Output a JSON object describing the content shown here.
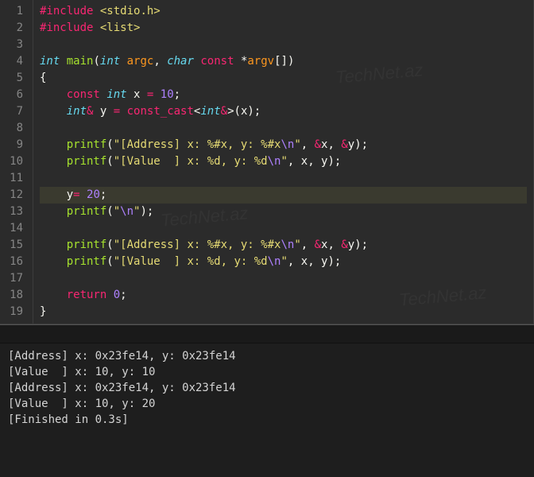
{
  "editor": {
    "lines": [
      {
        "num": "1",
        "hl": false,
        "tokens": [
          [
            "red",
            "#include"
          ],
          [
            "default",
            " "
          ],
          [
            "string",
            "<stdio.h>"
          ]
        ]
      },
      {
        "num": "2",
        "hl": false,
        "tokens": [
          [
            "red",
            "#include"
          ],
          [
            "default",
            " "
          ],
          [
            "string",
            "<list>"
          ]
        ]
      },
      {
        "num": "3",
        "hl": false,
        "tokens": []
      },
      {
        "num": "4",
        "hl": false,
        "tokens": [
          [
            "cyan",
            "int"
          ],
          [
            "default",
            " "
          ],
          [
            "green",
            "main"
          ],
          [
            "default",
            "("
          ],
          [
            "cyan",
            "int"
          ],
          [
            "default",
            " "
          ],
          [
            "orange",
            "argc"
          ],
          [
            "default",
            ", "
          ],
          [
            "cyan",
            "char"
          ],
          [
            "default",
            " "
          ],
          [
            "red",
            "const"
          ],
          [
            "default",
            " *"
          ],
          [
            "orange",
            "argv"
          ],
          [
            "default",
            "[])"
          ]
        ]
      },
      {
        "num": "5",
        "hl": false,
        "tokens": [
          [
            "default",
            "{"
          ]
        ]
      },
      {
        "num": "6",
        "hl": false,
        "tokens": [
          [
            "default",
            "    "
          ],
          [
            "red",
            "const"
          ],
          [
            "default",
            " "
          ],
          [
            "cyan",
            "int"
          ],
          [
            "default",
            " x "
          ],
          [
            "red",
            "="
          ],
          [
            "default",
            " "
          ],
          [
            "num",
            "10"
          ],
          [
            "default",
            ";"
          ]
        ]
      },
      {
        "num": "7",
        "hl": false,
        "tokens": [
          [
            "default",
            "    "
          ],
          [
            "cyan",
            "int"
          ],
          [
            "red",
            "&"
          ],
          [
            "default",
            " y "
          ],
          [
            "red",
            "="
          ],
          [
            "default",
            " "
          ],
          [
            "red",
            "const_cast"
          ],
          [
            "default",
            "<"
          ],
          [
            "cyan",
            "int"
          ],
          [
            "red",
            "&"
          ],
          [
            "default",
            ">(x);"
          ]
        ]
      },
      {
        "num": "8",
        "hl": false,
        "tokens": []
      },
      {
        "num": "9",
        "hl": false,
        "tokens": [
          [
            "default",
            "    "
          ],
          [
            "green",
            "printf"
          ],
          [
            "default",
            "("
          ],
          [
            "string",
            "\"[Address] x: %#x, y: %#x"
          ],
          [
            "num",
            "\\n"
          ],
          [
            "string",
            "\""
          ],
          [
            "default",
            ", "
          ],
          [
            "red",
            "&"
          ],
          [
            "default",
            "x, "
          ],
          [
            "red",
            "&"
          ],
          [
            "default",
            "y);"
          ]
        ]
      },
      {
        "num": "10",
        "hl": false,
        "tokens": [
          [
            "default",
            "    "
          ],
          [
            "green",
            "printf"
          ],
          [
            "default",
            "("
          ],
          [
            "string",
            "\"[Value  ] x: %d, y: %d"
          ],
          [
            "num",
            "\\n"
          ],
          [
            "string",
            "\""
          ],
          [
            "default",
            ", x, y);"
          ]
        ]
      },
      {
        "num": "11",
        "hl": false,
        "tokens": []
      },
      {
        "num": "12",
        "hl": true,
        "tokens": [
          [
            "default",
            "    y"
          ],
          [
            "red",
            "="
          ],
          [
            "default",
            " "
          ],
          [
            "num",
            "20"
          ],
          [
            "default",
            ";"
          ]
        ]
      },
      {
        "num": "13",
        "hl": false,
        "tokens": [
          [
            "default",
            "    "
          ],
          [
            "green",
            "printf"
          ],
          [
            "default",
            "("
          ],
          [
            "string",
            "\""
          ],
          [
            "num",
            "\\n"
          ],
          [
            "string",
            "\""
          ],
          [
            "default",
            ");"
          ]
        ]
      },
      {
        "num": "14",
        "hl": false,
        "tokens": []
      },
      {
        "num": "15",
        "hl": false,
        "tokens": [
          [
            "default",
            "    "
          ],
          [
            "green",
            "printf"
          ],
          [
            "default",
            "("
          ],
          [
            "string",
            "\"[Address] x: %#x, y: %#x"
          ],
          [
            "num",
            "\\n"
          ],
          [
            "string",
            "\""
          ],
          [
            "default",
            ", "
          ],
          [
            "red",
            "&"
          ],
          [
            "default",
            "x, "
          ],
          [
            "red",
            "&"
          ],
          [
            "default",
            "y);"
          ]
        ]
      },
      {
        "num": "16",
        "hl": false,
        "tokens": [
          [
            "default",
            "    "
          ],
          [
            "green",
            "printf"
          ],
          [
            "default",
            "("
          ],
          [
            "string",
            "\"[Value  ] x: %d, y: %d"
          ],
          [
            "num",
            "\\n"
          ],
          [
            "string",
            "\""
          ],
          [
            "default",
            ", x, y);"
          ]
        ]
      },
      {
        "num": "17",
        "hl": false,
        "tokens": []
      },
      {
        "num": "18",
        "hl": false,
        "tokens": [
          [
            "default",
            "    "
          ],
          [
            "red",
            "return"
          ],
          [
            "default",
            " "
          ],
          [
            "num",
            "0"
          ],
          [
            "default",
            ";"
          ]
        ]
      },
      {
        "num": "19",
        "hl": false,
        "tokens": [
          [
            "default",
            "}"
          ]
        ]
      }
    ]
  },
  "terminal": {
    "lines": [
      "[Address] x: 0x23fe14, y: 0x23fe14",
      "[Value  ] x: 10, y: 10",
      "",
      "[Address] x: 0x23fe14, y: 0x23fe14",
      "[Value  ] x: 10, y: 20",
      "[Finished in 0.3s]"
    ]
  },
  "watermark": "TechNet.az"
}
